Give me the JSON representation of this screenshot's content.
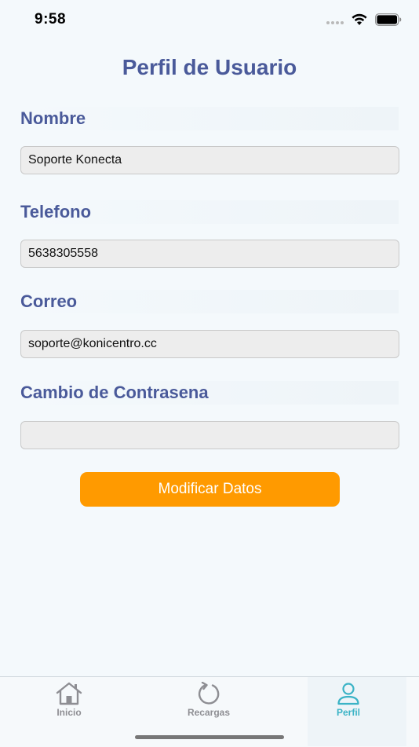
{
  "status_bar": {
    "time": "9:58",
    "icons": [
      "cellular-dots-icon",
      "wifi-icon",
      "battery-icon"
    ]
  },
  "header": {
    "title": "Perfil de Usuario"
  },
  "form": {
    "name": {
      "label": "Nombre",
      "value": "Soporte Konecta"
    },
    "phone": {
      "label": "Telefono",
      "value": "5638305558"
    },
    "email": {
      "label": "Correo",
      "value": "soporte@konicentro.cc"
    },
    "password": {
      "label": "Cambio de Contrasena",
      "value": ""
    },
    "submit_label": "Modificar Datos"
  },
  "tab_bar": {
    "tabs": [
      {
        "label": "Inicio",
        "icon": "house-icon",
        "active": false
      },
      {
        "label": "Recargas",
        "icon": "refresh-icon",
        "active": false
      },
      {
        "label": "Perfil",
        "icon": "person-icon",
        "active": true
      }
    ]
  },
  "colors": {
    "background": "#f4f9fc",
    "title": "#4a5a9a",
    "button": "#ff9a00",
    "active_tab": "#3bb3c6",
    "inactive_tab": "#8e8e93"
  }
}
